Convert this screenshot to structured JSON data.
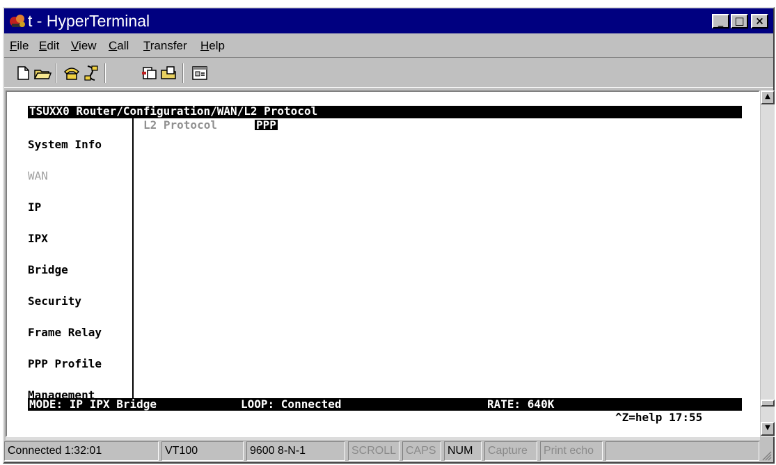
{
  "window": {
    "title": "t - HyperTerminal",
    "controls": {
      "minimize": "_",
      "maximize": "□",
      "close": "×"
    }
  },
  "menu": [
    {
      "label": "File",
      "accel": "F",
      "rest": "ile"
    },
    {
      "label": "Edit",
      "accel": "E",
      "rest": "dit"
    },
    {
      "label": "View",
      "accel": "V",
      "rest": "iew"
    },
    {
      "label": "Call",
      "accel": "C",
      "rest": "all"
    },
    {
      "label": "Transfer",
      "accel": "T",
      "rest": "ransfer"
    },
    {
      "label": "Help",
      "accel": "H",
      "rest": "elp"
    }
  ],
  "toolbar": {
    "buttons": [
      "new-icon",
      "open-icon",
      "connect-icon",
      "disconnect-icon",
      "send-icon",
      "receive-icon",
      "properties-icon"
    ]
  },
  "terminal": {
    "header": "TSUXX0 Router/Configuration/WAN/L2 Protocol",
    "sidebar": [
      "System Info",
      "WAN",
      "IP",
      "IPX",
      "Bridge",
      "Security",
      "Frame Relay",
      "PPP Profile",
      "Management"
    ],
    "dim_item": "WAN",
    "field_label": "L2 Protocol",
    "field_value": "PPP",
    "mode": "MODE: IP IPX Bridge",
    "loop": "LOOP: Connected",
    "rate": "RATE: 640K",
    "help": "^Z=help 17:55"
  },
  "status": {
    "connected": "Connected 1:32:01",
    "emulation": "VT100",
    "port": "9600 8-N-1",
    "scroll": "SCROLL",
    "caps": "CAPS",
    "num": "NUM",
    "capture": "Capture",
    "print_echo": "Print echo"
  },
  "colors": {
    "titlebar": "#000080",
    "chrome": "#c0c0c0",
    "terminal_bg": "#ffffff",
    "terminal_fg": "#000000"
  }
}
